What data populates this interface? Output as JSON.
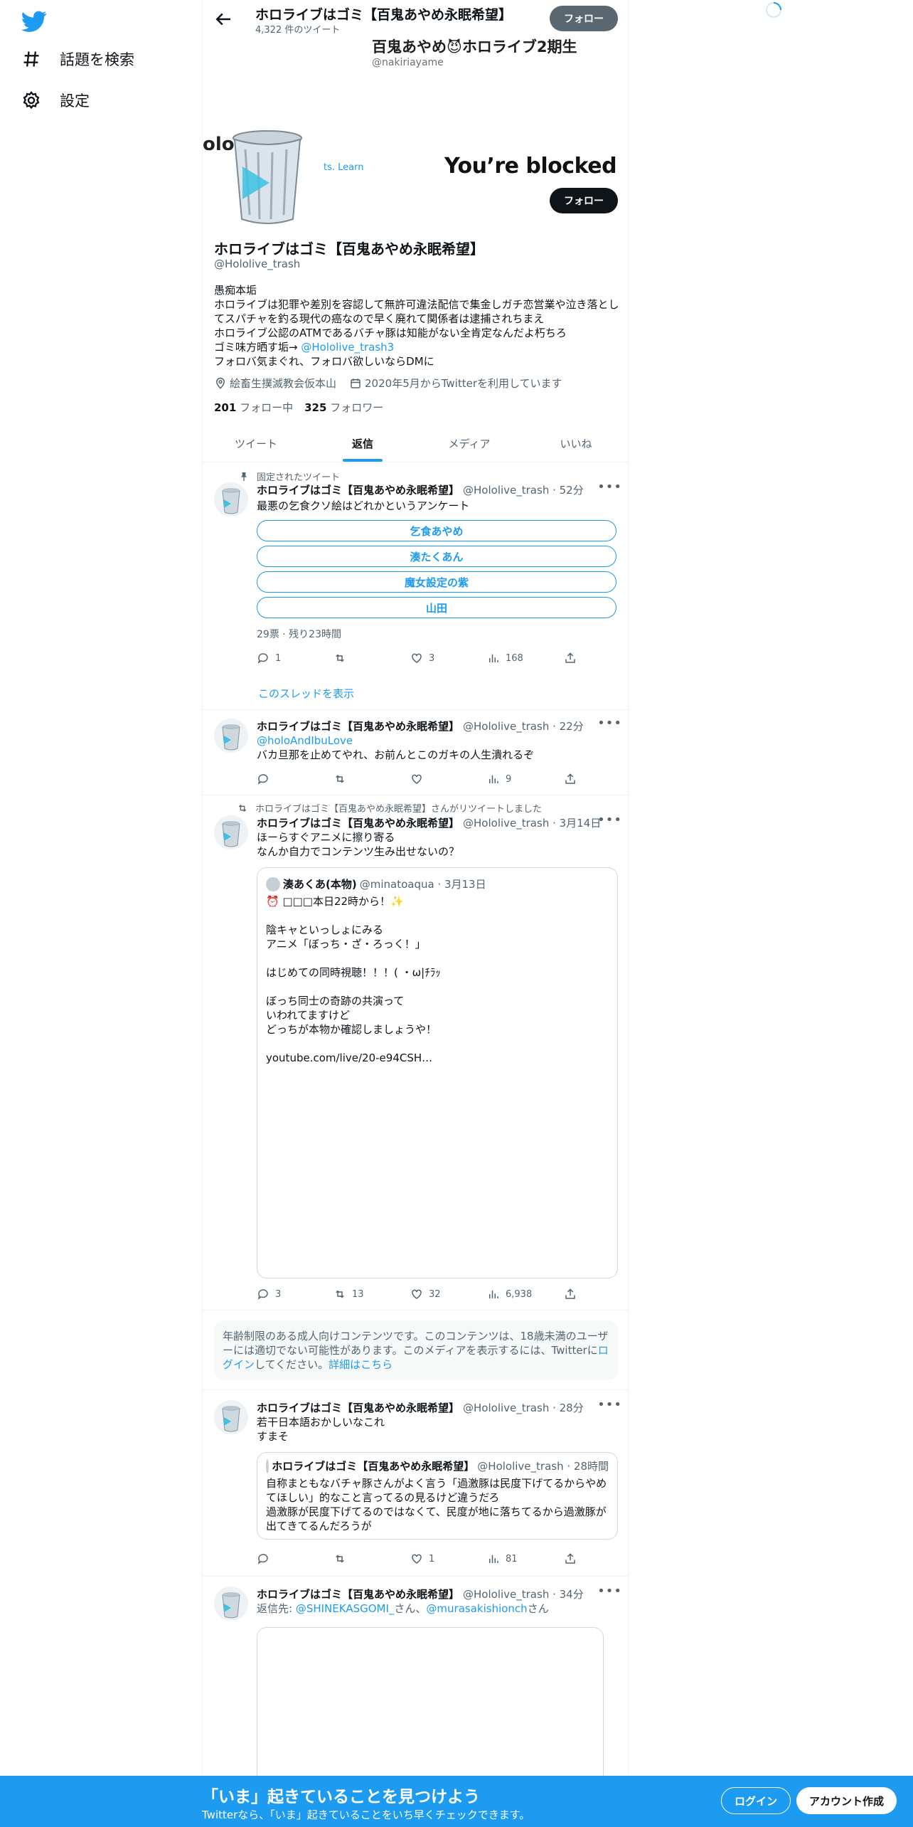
{
  "nav": {
    "explore_label": "話題を検索",
    "settings_label": "設定"
  },
  "topbar": {
    "title": "ホロライブはゴミ【百鬼あやめ永眠希望】",
    "tweet_count": "4,322 件のツイート",
    "follow_label": "フォロー"
  },
  "banner": {
    "name_text": "百鬼あやめ😈ホロライブ2期生",
    "handle_text": "@nakiriayame",
    "frag_left": "olo",
    "frag_link": "ts. Learn",
    "blocked_text": "You’re blocked"
  },
  "profile": {
    "name": "ホロライブはゴミ【百鬼あやめ永眠希望】",
    "handle": "@Hololive_trash",
    "follow_label": "フォロー",
    "bio_line1": "愚痴本垢",
    "bio_line2": "ホロライブは犯罪や差別を容認して無許可違法配信で集金しガチ恋営業や泣き落としてスパチャを釣る現代の癌なので早く廃れて関係者は逮捕されちまえ",
    "bio_line3": "ホロライブ公認のATMであるバチャ豚は知能がない全肯定なんだよ朽ちろ",
    "bio_line4_prefix": " ゴミ味方晒す垢→ ",
    "bio_line4_link": "@Hololive_trash3",
    "bio_line5": "フォロバ気まぐれ、フォロバ欲しいならDMに",
    "location": "絵畜生撲滅教会仮本山",
    "joined": "2020年5月からTwitterを利用しています",
    "following_count": "201",
    "following_label": "フォロー中",
    "followers_count": "325",
    "followers_label": "フォロワー"
  },
  "tabs": [
    "ツイート",
    "返信",
    "メディア",
    "いいね"
  ],
  "tweets": [
    {
      "pinned_label": "固定されたツイート",
      "name": "ホロライブはゴミ【百鬼あやめ永眠希望】",
      "meta": "@Hololive_trash · 52分",
      "text": "最悪の乞食クソ絵はどれかというアンケート",
      "poll": [
        "乞食あやめ",
        "湊たくあん",
        "魔女設定の紫",
        "山田"
      ],
      "poll_info": "29票 · 残り23時間",
      "replies": "1",
      "retweets": "",
      "likes": "3",
      "views": "168",
      "thread_link": "このスレッドを表示"
    },
    {
      "name": "ホロライブはゴミ【百鬼あやめ永眠希望】",
      "meta": "@Hololive_trash · 22分",
      "mention": "@holoAndIbuLove",
      "text": "バカ旦那を止めてやれ、お前んとこのガキの人生潰れるぞ",
      "replies": "",
      "retweets": "",
      "likes": "",
      "views": "9"
    },
    {
      "retweet_label": "ホロライブはゴミ【百鬼あやめ永眠希望】さんがリツイートしました",
      "name": "ホロライブはゴミ【百鬼あやめ永眠希望】",
      "meta": "@Hololive_trash · 3月14日",
      "text1": "ほーらすぐアニメに擦り寄る",
      "text2": "なんか自力でコンテンツ生み出せないの？",
      "quote_name": "湊あくあ(本物)",
      "quote_meta": "@minatoaqua · 3月13日",
      "quote_lines": [
        "⏰ □□□本日22時から！✨",
        "",
        "陰キャといっしょにみる",
        "アニメ「ぼっち・ざ・ろっく！」",
        "",
        "はじめての同時視聴！！！( ・ω|ﾁﾗｯ",
        "",
        "ぼっち同士の奇跡の共演って",
        "いわれてますけど",
        "どっちが本物か確認しましょうや！",
        "",
        "youtube.com/live/20-e94CSH…"
      ],
      "replies": "3",
      "retweets": "13",
      "likes": "32",
      "views": "6,938"
    },
    {
      "age_text1": "年齢制限のある成人向けコンテンツです。このコンテンツは、18歳未満のユーザーには適切でない可能性があります。このメディアを表示するには、Twitter",
      "age_text2_pre": "に",
      "age_login": "ログイン",
      "age_text2_mid": "してください。",
      "age_more": "詳細はこちら"
    },
    {
      "name": "ホロライブはゴミ【百鬼あやめ永眠希望】",
      "meta": "@Hololive_trash · 28分",
      "text1": "若干日本語おかしいなこれ",
      "text2": "すまそ",
      "quote_name": "ホロライブはゴミ【百鬼あやめ永眠希望】",
      "quote_meta": "@Hololive_trash · 28時間",
      "quote_lines": [
        "自称まともなバチャ豚さんがよく言う「過激豚は民度下げてるからやめてほしい」的なこと言ってるの見るけど違うだろ",
        "過激豚が民度下げてるのではなくて、民度が地に落ちてるから過激豚が出てきてるんだろうが"
      ],
      "replies": "",
      "retweets": "",
      "likes": "1",
      "views": "81"
    },
    {
      "name": "ホロライブはゴミ【百鬼あやめ永眠希望】",
      "meta": "@Hololive_trash · 34分",
      "reply_prefix": "返信先: ",
      "reply_to1": "@SHINEKASGOMI_",
      "reply_san1": "さん、",
      "reply_to2": "@murasakishionch",
      "reply_san2": "さん"
    }
  ],
  "bottom": {
    "title": "「いま」起きていることを見つけよう",
    "subtitle": "Twitterなら、「いま」起きていることをいち早くチェックできます。",
    "login_label": "ログイン",
    "signup_label": "アカウント作成"
  },
  "icons": [
    "twitter-bird-icon",
    "hashtag-icon",
    "gear-icon",
    "back-arrow-icon",
    "location-icon",
    "calendar-icon",
    "reply-icon",
    "retweet-icon",
    "like-icon",
    "views-icon",
    "share-icon",
    "pin-icon",
    "more-icon",
    "spinner-icon"
  ],
  "colors": {
    "accent": "#1d9bf0",
    "text": "#0f1419",
    "muted": "#536471"
  }
}
